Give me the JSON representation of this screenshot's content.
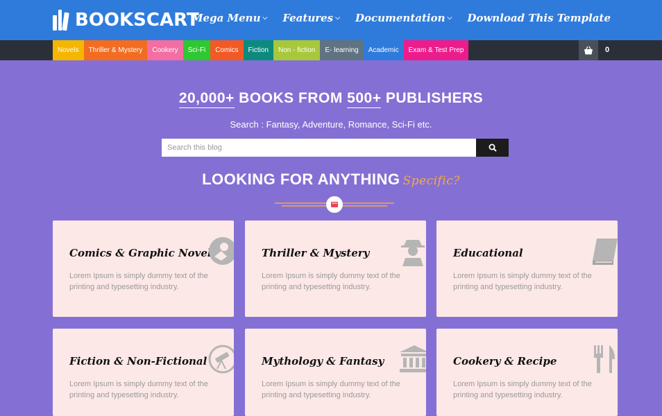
{
  "header": {
    "logo_text": "BOOKSCART",
    "nav": [
      {
        "label": "Mega Menu",
        "caret": true
      },
      {
        "label": "Features",
        "caret": true
      },
      {
        "label": "Documentation",
        "caret": true
      },
      {
        "label": "Download This Template",
        "caret": false
      }
    ]
  },
  "categories": [
    {
      "label": "Novels",
      "color": "#f5b600"
    },
    {
      "label": "Thriller & Mystery",
      "color": "#f26c21"
    },
    {
      "label": "Cookery",
      "color": "#f36ea2"
    },
    {
      "label": "Sci-Fi",
      "color": "#2fc732"
    },
    {
      "label": "Comics",
      "color": "#f15a24"
    },
    {
      "label": "Fiction",
      "color": "#0d8a7e"
    },
    {
      "label": "Non - fiction",
      "color": "#a8c83b"
    },
    {
      "label": "E- learning",
      "color": "#5f7380"
    },
    {
      "label": "Academic",
      "color": "#2f7bdc"
    },
    {
      "label": "Exam & Test Prep",
      "color": "#ec1c8c"
    }
  ],
  "cart": {
    "count": "0",
    "icon": "shopping-bag-icon"
  },
  "hero": {
    "title_num1": "20,000+",
    "title_mid": "BOOKS FROM",
    "title_num2": "500+",
    "title_end": "PUBLISHERS",
    "subtitle": "Search : Fantasy, Adventure, Romance, Sci-Fi etc.",
    "search_placeholder": "Search this blog"
  },
  "section": {
    "title": "LOOKING FOR ANYTHING",
    "accent": "Specific?"
  },
  "cards": [
    {
      "title": "Comics & Graphic Novels",
      "text": "Lorem Ipsum is simply dummy text of the printing and typesetting industry.",
      "icon": "astronaut-icon"
    },
    {
      "title": "Thriller & Mystery",
      "text": "Lorem Ipsum is simply dummy text of the printing and typesetting industry.",
      "icon": "detective-icon"
    },
    {
      "title": "Educational",
      "text": "Lorem Ipsum is simply dummy text of the printing and typesetting industry.",
      "icon": "book-icon"
    },
    {
      "title": "Fiction & Non-Fictional",
      "text": "Lorem Ipsum is simply dummy text of the printing and typesetting industry.",
      "icon": "telescope-icon"
    },
    {
      "title": "Mythology & Fantasy",
      "text": "Lorem Ipsum is simply dummy text of the printing and typesetting industry.",
      "icon": "temple-icon"
    },
    {
      "title": "Cookery & Recipe",
      "text": "Lorem Ipsum is simply dummy text of the printing and typesetting industry.",
      "icon": "fork-knife-icon"
    }
  ],
  "colors": {
    "header": "#2f7bdc",
    "catbar": "#2b2f38",
    "background": "#8470d4",
    "card": "#fce8e7",
    "accent": "#f6a84b"
  }
}
